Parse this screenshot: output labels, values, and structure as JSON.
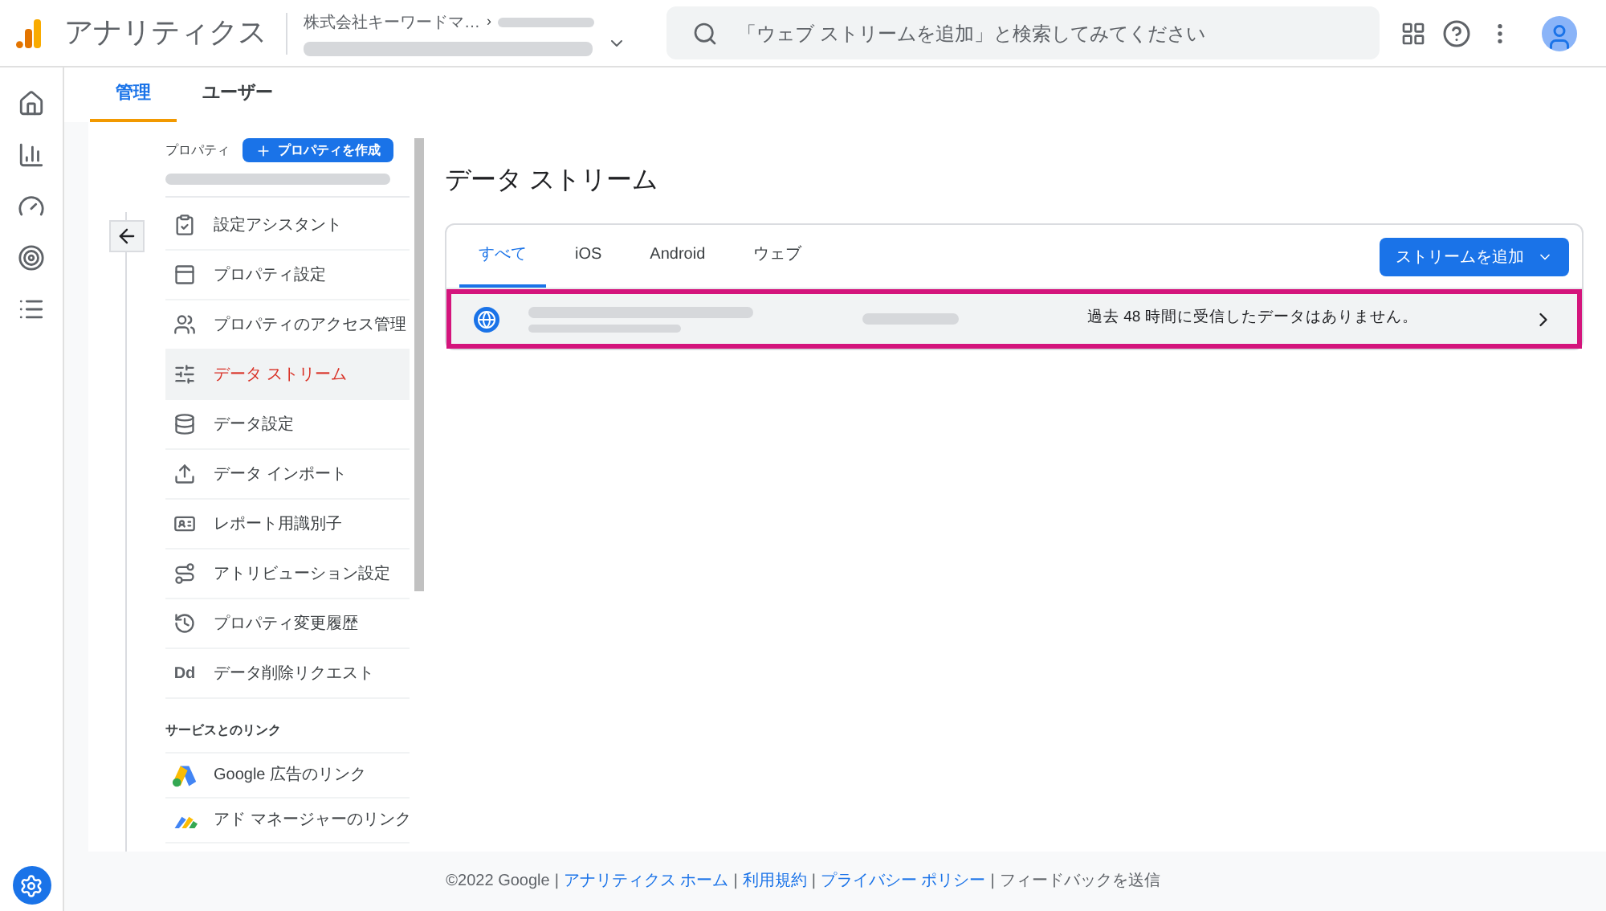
{
  "header": {
    "product": "アナリティクス",
    "account": "株式会社キーワードマ…",
    "account_separator": "›",
    "search_placeholder": "「ウェブ ストリームを追加」と検索してみてください"
  },
  "top_tabs": [
    {
      "label": "管理",
      "selected": true
    },
    {
      "label": "ユーザー",
      "selected": false
    }
  ],
  "property": {
    "label": "プロパティ",
    "create_button": "プロパティを作成"
  },
  "nav_items": [
    {
      "kind": "assistant",
      "label": "設定アシスタント",
      "selected": false
    },
    {
      "kind": "settings",
      "label": "プロパティ設定",
      "selected": false
    },
    {
      "kind": "access",
      "label": "プロパティのアクセス管理",
      "selected": false
    },
    {
      "kind": "streams",
      "label": "データ ストリーム",
      "selected": true
    },
    {
      "kind": "data",
      "label": "データ設定",
      "selected": false
    },
    {
      "kind": "import",
      "label": "データ インポート",
      "selected": false
    },
    {
      "kind": "identity",
      "label": "レポート用識別子",
      "selected": false
    },
    {
      "kind": "attribution",
      "label": "アトリビューション設定",
      "selected": false
    },
    {
      "kind": "history",
      "label": "プロパティ変更履歴",
      "selected": false
    },
    {
      "kind": "text",
      "icon_text": "Dd",
      "label": "データ削除リクエスト",
      "selected": false
    }
  ],
  "links_section": {
    "title": "サービスとのリンク",
    "items": [
      {
        "kind": "google-ads",
        "label": "Google 広告のリンク"
      },
      {
        "kind": "ad-manager",
        "label": "アド マネージャーのリンク"
      }
    ]
  },
  "page_title": "データ ストリーム",
  "stream_tabs": [
    {
      "label": "すべて",
      "selected": true
    },
    {
      "label": "iOS",
      "selected": false
    },
    {
      "label": "Android",
      "selected": false
    },
    {
      "label": "ウェブ",
      "selected": false
    }
  ],
  "add_button": "ストリームを追加",
  "streams": [
    {
      "status": "過去 48 時間に受信したデータはありません。",
      "highlighted": true
    }
  ],
  "footer": [
    {
      "kind": "text",
      "text": "©2022 Google"
    },
    {
      "kind": "separator",
      "text": "|"
    },
    {
      "kind": "link",
      "text": "アナリティクス ホーム"
    },
    {
      "kind": "separator",
      "text": "|"
    },
    {
      "kind": "link",
      "text": "利用規約"
    },
    {
      "kind": "separator",
      "text": "|"
    },
    {
      "kind": "link",
      "text": "プライバシー ポリシー"
    },
    {
      "kind": "separator",
      "text": "|"
    },
    {
      "kind": "text",
      "text": "フィードバックを送信"
    }
  ]
}
